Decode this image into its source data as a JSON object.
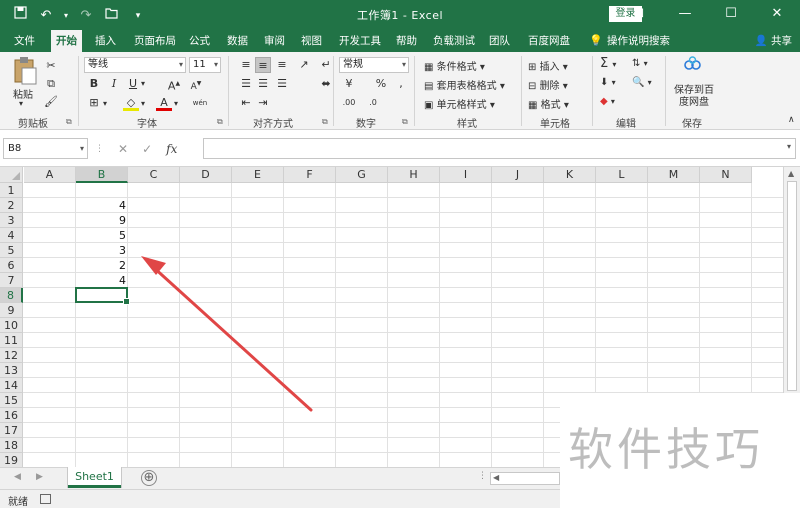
{
  "window": {
    "title": "工作簿1 - Excel",
    "login_label": "登录",
    "controls": [
      "⊡",
      "—",
      "☐",
      "✕"
    ]
  },
  "quick_access": {
    "icons": [
      "save-icon",
      "undo-icon",
      "redo-icon",
      "open-icon",
      "more-icon"
    ]
  },
  "tabs": [
    {
      "label": "文件",
      "active": false
    },
    {
      "label": "开始",
      "active": true
    },
    {
      "label": "插入",
      "active": false
    },
    {
      "label": "页面布局",
      "active": false
    },
    {
      "label": "公式",
      "active": false
    },
    {
      "label": "数据",
      "active": false
    },
    {
      "label": "审阅",
      "active": false
    },
    {
      "label": "视图",
      "active": false
    },
    {
      "label": "开发工具",
      "active": false
    },
    {
      "label": "帮助",
      "active": false
    },
    {
      "label": "负载测试",
      "active": false
    },
    {
      "label": "团队",
      "active": false
    },
    {
      "label": "百度网盘",
      "active": false
    },
    {
      "label": "操作说明搜索",
      "active": false
    }
  ],
  "share_label": "共享",
  "ribbon": {
    "clipboard": {
      "label": "剪贴板",
      "paste_label": "粘贴"
    },
    "font": {
      "label": "字体",
      "font_name": "等线",
      "font_size": "11",
      "bold": "B",
      "italic": "I",
      "underline": "U",
      "font_color_glyph": "A",
      "phonetic_glyph": "wén"
    },
    "alignment": {
      "label": "对齐方式"
    },
    "number": {
      "label": "数字",
      "format": "常规",
      "percent": "%",
      "comma": ","
    },
    "styles": {
      "label": "样式",
      "conditional": "条件格式",
      "table": "套用表格格式",
      "cell": "单元格样式"
    },
    "cells": {
      "label": "单元格",
      "insert": "插入",
      "delete": "删除",
      "format": "格式"
    },
    "editing": {
      "label": "编辑",
      "sum_glyph": "Σ"
    },
    "save": {
      "label": "保存",
      "button": "保存到百度网盘"
    }
  },
  "formula_bar": {
    "name_box": "B8",
    "cancel_glyph": "✕",
    "enter_glyph": "✓",
    "fx_glyph": "fx",
    "formula": ""
  },
  "grid": {
    "columns": [
      "A",
      "B",
      "C",
      "D",
      "E",
      "F",
      "G",
      "H",
      "I",
      "J",
      "K",
      "L",
      "M",
      "N"
    ],
    "rows": [
      "1",
      "2",
      "3",
      "4",
      "5",
      "6",
      "7",
      "8",
      "9",
      "10",
      "11",
      "12",
      "13",
      "14",
      "15",
      "16",
      "17",
      "18",
      "19"
    ],
    "selected_column": "B",
    "selected_row": "8",
    "values": {
      "B2": "4",
      "B3": "9",
      "B4": "5",
      "B5": "3",
      "B6": "2",
      "B7": "4"
    }
  },
  "sheets": [
    {
      "label": "Sheet1",
      "active": true
    }
  ],
  "add_sheet_glyph": "⊕",
  "status": {
    "text": "就绪"
  },
  "watermark": {
    "text": "软件技巧"
  },
  "colors": {
    "accent": "#217346",
    "annotation_arrow": "#e04646",
    "watermark": "#bdbdbd"
  }
}
